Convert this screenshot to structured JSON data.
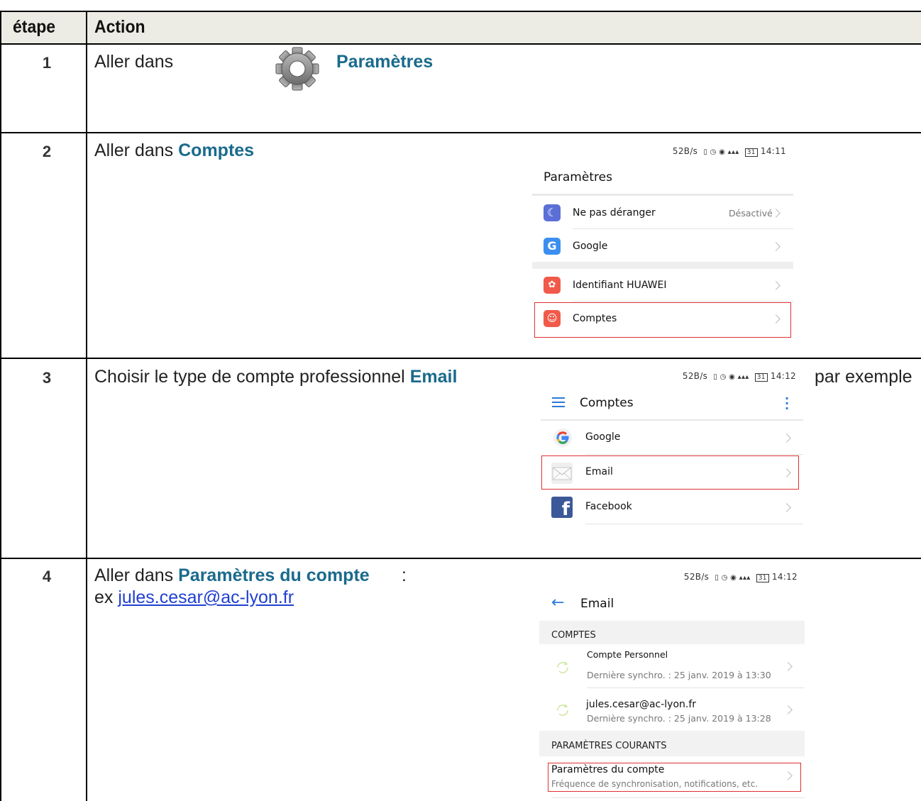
{
  "table": {
    "headers": {
      "step": "étape",
      "action": "Action"
    },
    "rows": [
      {
        "num": "1",
        "prefix": "Aller dans",
        "highlight": "Paramètres"
      },
      {
        "num": "2",
        "prefix": "Aller dans ",
        "highlight": "Comptes"
      },
      {
        "num": "3",
        "prefix": "Choisir le type de compte professionnel ",
        "highlight": "Email",
        "suffix": "par exemple"
      },
      {
        "num": "4",
        "prefix": "Aller dans ",
        "highlight": "Paramètres du compte",
        "colon": ":",
        "ex_prefix": "ex ",
        "ex_link": "jules.cesar@ac-lyon.fr"
      }
    ]
  },
  "shot1": {
    "status": {
      "speed": "52B/s",
      "time": "14:11",
      "battery": "31"
    },
    "title": "Paramètres",
    "items": [
      {
        "label": "Ne pas déranger",
        "value": "Désactivé",
        "icon": "moon-icon",
        "color": "#5b6fd6"
      },
      {
        "label": "Google",
        "icon": "google-g-icon",
        "color": "#3c8ff0"
      },
      {
        "label": "Identifiant HUAWEI",
        "icon": "huawei-icon",
        "color": "#f15a4a"
      },
      {
        "label": "Comptes",
        "icon": "account-icon",
        "color": "#f15a4a"
      }
    ]
  },
  "shot2": {
    "status": {
      "speed": "52B/s",
      "time": "14:12",
      "battery": "31"
    },
    "title": "Comptes",
    "items": [
      {
        "label": "Google",
        "icon": "google-logo-icon"
      },
      {
        "label": "Email",
        "icon": "envelope-icon"
      },
      {
        "label": "Facebook",
        "icon": "facebook-icon",
        "color": "#3b5998"
      }
    ]
  },
  "shot3": {
    "status": {
      "speed": "52B/s",
      "time": "14:12",
      "battery": "31"
    },
    "title": "Email",
    "section1": "COMPTES",
    "accounts": [
      {
        "name": "Compte Personnel",
        "sync": "Dernière synchro. : 25 janv. 2019 à 13:30"
      },
      {
        "name": "jules.cesar@ac-lyon.fr",
        "sync": "Dernière synchro. : 25 janv. 2019 à 13:28"
      }
    ],
    "section2": "PARAMÈTRES COURANTS",
    "setting": {
      "label": "Paramètres du compte",
      "sub": "Fréquence de synchronisation, notifications, etc."
    }
  }
}
